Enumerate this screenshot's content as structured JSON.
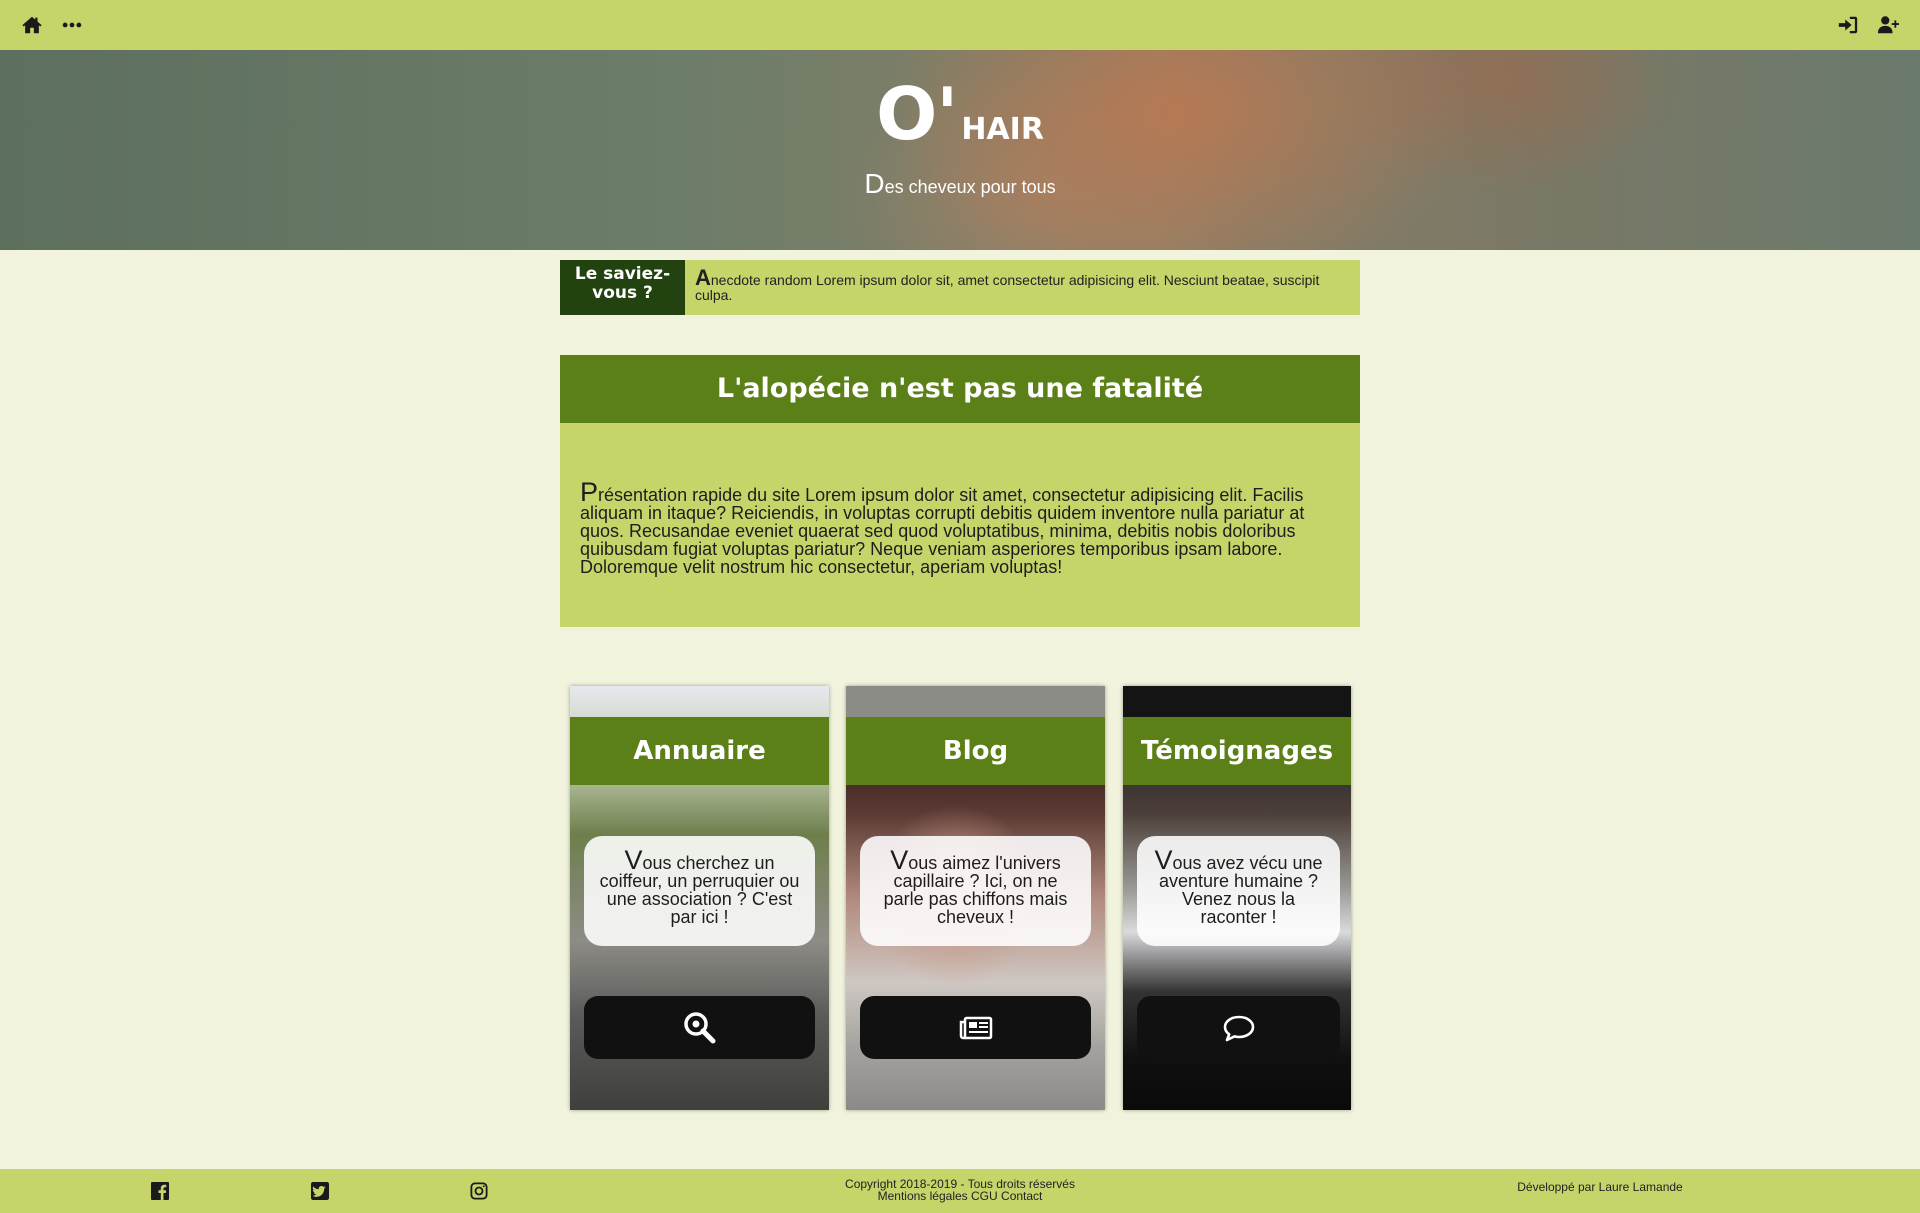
{
  "nav": {
    "left_icons": [
      "home-icon",
      "more-icon"
    ],
    "right_icons": [
      "sign-in-icon",
      "user-plus-icon"
    ]
  },
  "hero": {
    "brand_big": "O'",
    "brand_small": "HAIR",
    "subtitle_cap": "D",
    "subtitle_rest": "es cheveux pour tous"
  },
  "did_you_know": {
    "label": "Le saviez-vous ?",
    "text_cap": "A",
    "text_rest": "necdote random Lorem ipsum dolor sit, amet consectetur adipisicing elit. Nesciunt beatae, suscipit culpa."
  },
  "intro": {
    "title": "L'alopécie n'est pas une fatalité",
    "body_cap": "P",
    "body_rest": "résentation rapide du site Lorem ipsum dolor sit amet, consectetur adipisicing elit. Facilis aliquam in itaque? Reiciendis, in voluptas corrupti debitis quidem inventore nulla pariatur at quos. Recusandae eveniet quaerat sed quod voluptatibus, minima, debitis nobis doloribus quibusdam fugiat voluptas pariatur? Neque veniam asperiores temporibus ipsam labore. Doloremque velit nostrum hic consectetur, aperiam voluptas!"
  },
  "cards": [
    {
      "title": "Annuaire",
      "text_cap": "V",
      "text_rest": "ous cherchez un coiffeur, un perruquier ou une association ? C'est par ici !",
      "button_icon": "search-icon"
    },
    {
      "title": "Blog",
      "text_cap": "V",
      "text_rest": "ous aimez l'univers capillaire ? Ici, on ne parle pas chiffons mais cheveux !",
      "button_icon": "newspaper-icon"
    },
    {
      "title": "Témoignages",
      "text_cap": "V",
      "text_rest": "ous avez vécu une aventure humaine ? Venez nous la raconter !",
      "button_icon": "comment-icon"
    }
  ],
  "footer": {
    "social_icons": [
      "facebook-icon",
      "twitter-icon",
      "instagram-icon"
    ],
    "copyright": "Copyright 2018-2019 - Tous droits réservés",
    "links": [
      "Mentions légales",
      "CGU",
      "Contact"
    ],
    "developer": "Développé par Laure Lamande"
  },
  "colors": {
    "nav_bg": "#c7d46a",
    "page_bg": "#f1f3dc",
    "title_green": "#5c8018",
    "dark_green": "#22420f"
  }
}
